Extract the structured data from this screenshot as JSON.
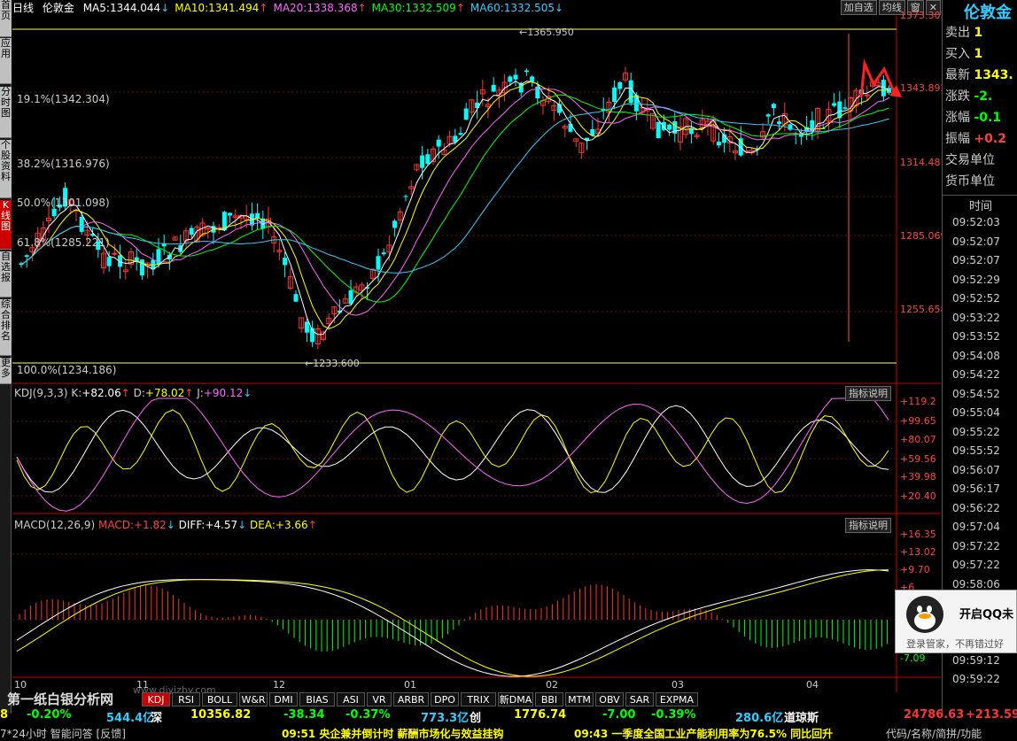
{
  "sidebar": [
    "首页",
    "应用",
    "分时图",
    "个股资料",
    "K线图",
    "自选报",
    "综合排名",
    "更多"
  ],
  "header": {
    "period": "日线",
    "symbol": "伦敦金",
    "ma": [
      {
        "label": "MA5:",
        "value": "1344.044",
        "arrow": "↓",
        "color": "#ffffff"
      },
      {
        "label": "MA10:",
        "value": "1341.494",
        "arrow": "↑",
        "color": "#ffff00"
      },
      {
        "label": "MA20:",
        "value": "1338.368",
        "arrow": "↑",
        "color": "#ff66ff"
      },
      {
        "label": "MA30:",
        "value": "1332.509",
        "arrow": "↑",
        "color": "#00ff00"
      },
      {
        "label": "MA60:",
        "value": "1332.505",
        "arrow": "↓",
        "color": "#33ccff"
      }
    ],
    "buttons": [
      "加自选",
      "均线",
      "窗",
      "✕"
    ]
  },
  "main_chart": {
    "fib": [
      "19.1%(1342.304)",
      "38.2%(1316.976)",
      "50.0%(1301.098)",
      "61.8%(1285.221)",
      "100.0%(1234.186)"
    ],
    "high_label": "1365.950",
    "low_label": "1233.600",
    "axis": [
      "1373.303",
      "1343.892",
      "1314.481",
      "1285.069",
      "1255.658"
    ],
    "colors": {
      "up": "#ff3232",
      "down": "#00ffff"
    }
  },
  "kdj": {
    "title": "KDJ(9,3,3)",
    "k_label": "K:",
    "k_value": "+82.06",
    "k_arrow": "↑",
    "d_label": "D:",
    "d_value": "+78.02",
    "d_arrow": "↑",
    "j_label": "J:",
    "j_value": "+90.12",
    "j_arrow": "↓",
    "button": "指标说明",
    "axis": [
      "+119.2",
      "+99.65",
      "+80.07",
      "+59.56",
      "+39.98",
      "+20.40"
    ]
  },
  "macd": {
    "title": "MACD(12,26,9)",
    "m_label": "MACD:",
    "m_value": "+1.82",
    "m_arrow": "↓",
    "diff_label": "DIFF:",
    "diff_value": "+4.57",
    "diff_arrow": "↓",
    "dea_label": "DEA:",
    "dea_value": "+3.66",
    "dea_arrow": "↑",
    "button": "指标说明",
    "axis": [
      "+16.35",
      "+13.02",
      "+9.70",
      "+6",
      "-7.09"
    ]
  },
  "x_axis": [
    "10",
    "11",
    "12",
    "01",
    "02",
    "03",
    "04"
  ],
  "right_panel": {
    "title": "伦敦金",
    "rows": [
      {
        "label": "卖出",
        "value": "1"
      },
      {
        "label": "买入",
        "value": "1"
      },
      {
        "label": "最新",
        "value": "1343."
      },
      {
        "label": "涨跌",
        "value": "-2."
      },
      {
        "label": "涨幅",
        "value": "-0.1"
      },
      {
        "label": "振幅",
        "value": "+0.2"
      },
      {
        "label": "交易单位",
        "value": ""
      },
      {
        "label": "货币单位",
        "value": ""
      }
    ],
    "time_header": "时间",
    "times": [
      "09:52:03",
      "09:52:07",
      "09:52:07",
      "09:52:29",
      "09:52:52",
      "09:53:22",
      "09:53:52",
      "09:54:08",
      "09:54:22",
      "09:54:52",
      "09:55:04",
      "09:55:22",
      "09:55:52",
      "09:56:07",
      "09:56:17",
      "09:56:22",
      "09:57:04",
      "09:57:22",
      "09:57:22",
      "09:58:06",
      "09:58:37",
      "09:58:52",
      "09:59:07",
      "09:59:12",
      "09:59:22"
    ]
  },
  "tabs": [
    "KDJ",
    "RSI",
    "BOLL",
    "W&R",
    "DMI",
    "BIAS",
    "ASI",
    "VR",
    "ARBR",
    "DPO",
    "TRIX",
    "新DMA",
    "BBI",
    "MTM",
    "OBV",
    "SAR",
    "EXPMA"
  ],
  "watermark": "第一纸白银分析网",
  "watermark_url": "www.diyizby.com",
  "status": {
    "items": [
      {
        "text": "8",
        "color": "#ffff00"
      },
      {
        "text": "-0.20%",
        "color": "#00ff00"
      },
      {
        "text": "544.4亿",
        "color": "#33ccff"
      },
      {
        "text": "深",
        "color": "#ffffff"
      },
      {
        "text": "10356.82",
        "color": "#ffff00"
      },
      {
        "text": "-38.34",
        "color": "#00ff00"
      },
      {
        "text": "-0.37%",
        "color": "#00ff00"
      },
      {
        "text": "773.3亿",
        "color": "#33ccff"
      },
      {
        "text": "创",
        "color": "#ffffff"
      },
      {
        "text": "1776.74",
        "color": "#ffff00"
      },
      {
        "text": "-7.00",
        "color": "#00ff00"
      },
      {
        "text": "-0.39%",
        "color": "#00ff00"
      },
      {
        "text": "280.6亿",
        "color": "#33ccff"
      },
      {
        "text": "道琼斯",
        "color": "#ffffff"
      },
      {
        "text": "24786.63",
        "color": "#ff3232"
      },
      {
        "text": "+213.59",
        "color": "#ff3232"
      }
    ]
  },
  "news": {
    "left": "7*24小时  智能问答 [反馈]",
    "n1": "09:51 央企兼并倒计时 薪酬市场化与效益挂钩",
    "n2": "09:43 一季度全国工业产能利用率为76.5% 同比回升",
    "right": "代码/名称/简拼/功能"
  },
  "popup": {
    "title": "开启QQ未",
    "body": "登录管家，不再错过好"
  }
}
